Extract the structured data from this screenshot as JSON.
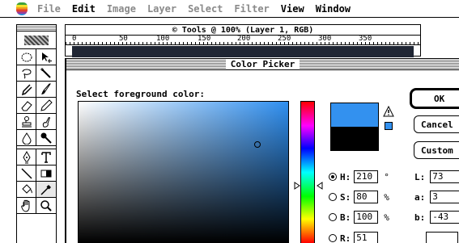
{
  "menubar": {
    "items": [
      {
        "label": "File",
        "dim": true
      },
      {
        "label": "Edit",
        "dim": false
      },
      {
        "label": "Image",
        "dim": true
      },
      {
        "label": "Layer",
        "dim": true
      },
      {
        "label": "Select",
        "dim": true
      },
      {
        "label": "Filter",
        "dim": true
      },
      {
        "label": "View",
        "dim": false
      },
      {
        "label": "Window",
        "dim": false
      }
    ]
  },
  "document": {
    "title": "© Tools @ 100% (Layer 1, RGB)",
    "ruler_labels": [
      "0",
      "50",
      "100",
      "150",
      "200",
      "250",
      "300",
      "350"
    ]
  },
  "toolbox": {
    "tools": [
      "marquee-icon",
      "move-icon",
      "lasso-icon",
      "magic-wand-icon",
      "crop-icon",
      "brush-icon",
      "eraser-icon",
      "pencil-icon",
      "stamp-icon",
      "smudge-icon",
      "dodge-icon",
      "burn-icon",
      "pen-icon",
      "type-icon",
      "line-icon",
      "gradient-icon",
      "bucket-icon",
      "eyedropper-icon",
      "hand-icon",
      "zoom-icon"
    ]
  },
  "color_picker": {
    "title": "Color Picker",
    "prompt": "Select foreground color:",
    "buttons": {
      "ok": "OK",
      "cancel": "Cancel",
      "custom": "Custom"
    },
    "hsb": {
      "h_label": "H:",
      "h_value": "210",
      "h_unit": "°",
      "s_label": "S:",
      "s_value": "80",
      "s_unit": "%",
      "b_label": "B:",
      "b_value": "100",
      "b_unit": "%",
      "c_label": "R:",
      "c_value": "51"
    },
    "lab": {
      "l_label": "L:",
      "l_value": "73",
      "a_label": "a:",
      "a_value": "3",
      "b_label": "b:",
      "b_value": "-43"
    },
    "colors": {
      "new": "#3391ef",
      "old": "#000000"
    }
  }
}
